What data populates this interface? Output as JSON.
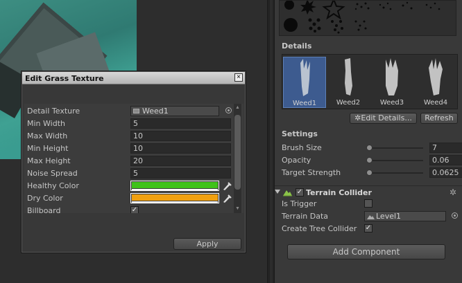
{
  "dialog": {
    "title": "Edit Grass Texture",
    "close_glyph": "×",
    "fields": {
      "detail_texture": {
        "label": "Detail Texture",
        "value": "Weed1"
      },
      "min_width": {
        "label": "Min Width",
        "value": "5"
      },
      "max_width": {
        "label": "Max Width",
        "value": "10"
      },
      "min_height": {
        "label": "Min Height",
        "value": "10"
      },
      "max_height": {
        "label": "Max Height",
        "value": "20"
      },
      "noise_spread": {
        "label": "Noise Spread",
        "value": "5"
      },
      "healthy_color": {
        "label": "Healthy Color",
        "color": "#3fc21a"
      },
      "dry_color": {
        "label": "Dry Color",
        "color": "#f0a010"
      },
      "billboard": {
        "label": "Billboard",
        "checked": true
      }
    },
    "apply_label": "Apply"
  },
  "inspector": {
    "details_title": "Details",
    "details": [
      {
        "label": "Weed1",
        "selected": true
      },
      {
        "label": "Weed2",
        "selected": false
      },
      {
        "label": "Weed3",
        "selected": false
      },
      {
        "label": "Weed4",
        "selected": false
      }
    ],
    "edit_details_label": "Edit Details...",
    "refresh_label": "Refresh",
    "settings_title": "Settings",
    "brush_size": {
      "label": "Brush Size",
      "value": "7"
    },
    "opacity": {
      "label": "Opacity",
      "value": "0.06"
    },
    "target_strength": {
      "label": "Target Strength",
      "value": "0.0625"
    },
    "collider": {
      "title": "Terrain Collider",
      "enabled": true,
      "is_trigger": {
        "label": "Is Trigger",
        "checked": false
      },
      "terrain_data": {
        "label": "Terrain Data",
        "value": "Level1"
      },
      "create_tree_colliders": {
        "label": "Create Tree Collider",
        "checked": true
      }
    },
    "add_component_label": "Add Component"
  },
  "colors": {
    "selection": "#3d5b8f",
    "panel": "#393939",
    "field": "#2a2a2a"
  },
  "icons": [
    "close-icon",
    "texture-icon",
    "object-picker-icon",
    "eyedropper-icon",
    "gear-icon",
    "terrain-collider-icon",
    "foldout-arrow-icon",
    "checkmark-icon"
  ]
}
